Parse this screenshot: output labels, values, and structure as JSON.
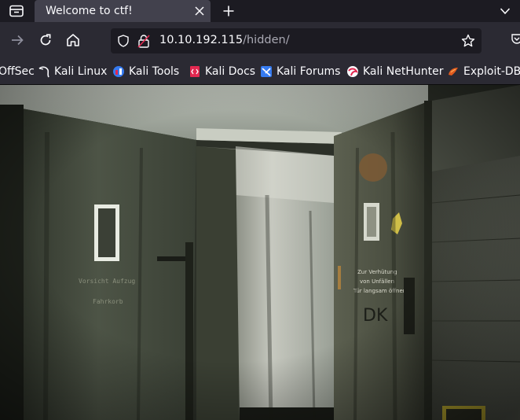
{
  "tab": {
    "title": "Welcome to ctf!"
  },
  "url": {
    "host": "10.10.192.115",
    "path": "/hidden/"
  },
  "bookmarks": [
    {
      "label": "OffSec",
      "icon": "offsec-icon"
    },
    {
      "label": "Kali Linux",
      "icon": "kali-dragon-icon"
    },
    {
      "label": "Kali Tools",
      "icon": "kali-tools-icon"
    },
    {
      "label": "Kali Docs",
      "icon": "kali-docs-icon"
    },
    {
      "label": "Kali Forums",
      "icon": "kali-forums-icon"
    },
    {
      "label": "Kali NetHunter",
      "icon": "nethunter-icon"
    },
    {
      "label": "Exploit-DB",
      "icon": "exploit-db-icon"
    }
  ],
  "image": {
    "description_sign_left": [
      "Vorsicht Aufzug",
      "Fahrkorb"
    ],
    "description_sign_right": [
      "Zur Verhütung",
      "von Unfällen",
      "Tür langsam öffnen"
    ],
    "graffiti": "DK"
  },
  "colors": {
    "tab_bg": "#42414d",
    "toolbar_bg": "#2b2a33",
    "window_bg": "#1c1b22"
  }
}
